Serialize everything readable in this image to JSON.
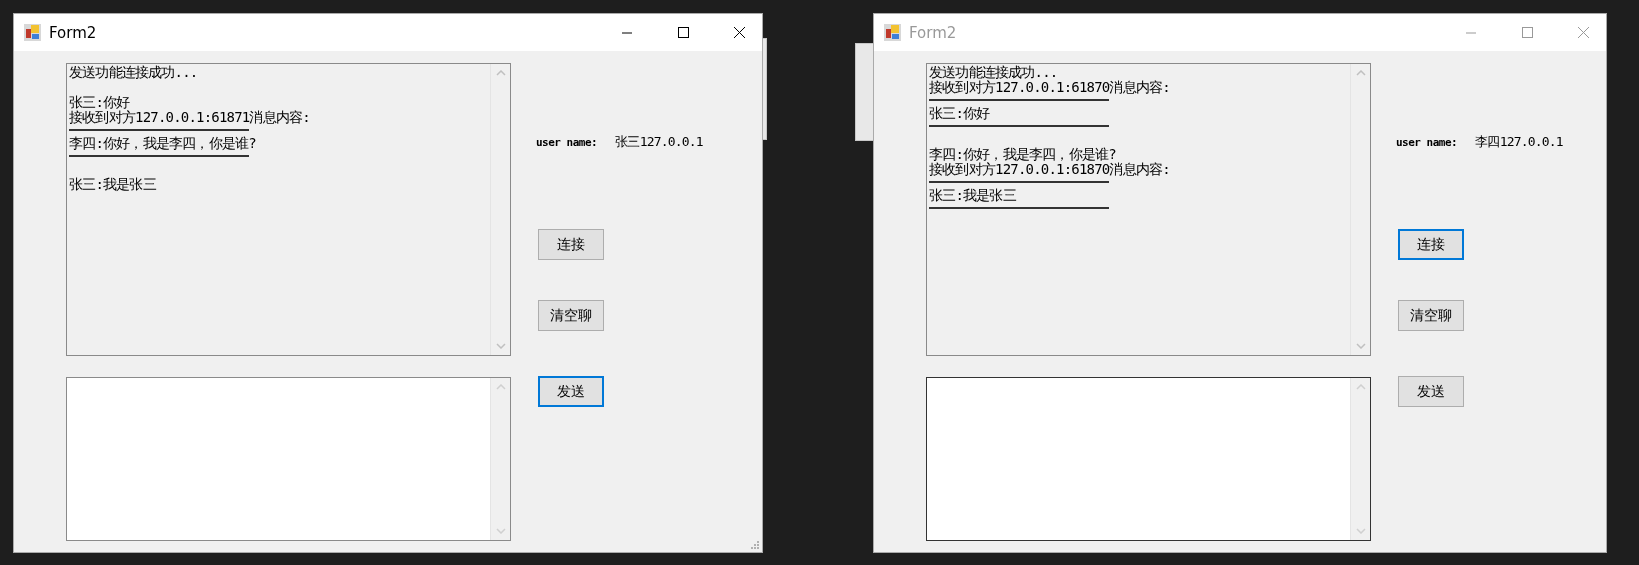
{
  "windows": [
    {
      "title": "Form2",
      "active": true,
      "chat_lines": [
        {
          "kind": "text",
          "text": "发送功能连接成功..."
        },
        {
          "kind": "blank"
        },
        {
          "kind": "text",
          "text": "张三:你好"
        },
        {
          "kind": "text",
          "text": "接收到对方127.0.0.1:61871消息内容:"
        },
        {
          "kind": "rule"
        },
        {
          "kind": "text",
          "text": "李四:你好，我是李四，你是谁?"
        },
        {
          "kind": "rule"
        },
        {
          "kind": "blank"
        },
        {
          "kind": "text",
          "text": "张三:我是张三"
        }
      ],
      "user_name_label": "user name:",
      "user_name_value": "张三127.0.0.1",
      "buttons": [
        {
          "label": "连接",
          "focused": false
        },
        {
          "label": "清空聊",
          "focused": false
        },
        {
          "label": "发送",
          "focused": true
        }
      ],
      "message_input": {
        "focused": false
      }
    },
    {
      "title": "Form2",
      "active": false,
      "chat_lines": [
        {
          "kind": "text",
          "text": "发送功能连接成功..."
        },
        {
          "kind": "text",
          "text": "接收到对方127.0.0.1:61870消息内容:"
        },
        {
          "kind": "rule"
        },
        {
          "kind": "text",
          "text": "张三:你好"
        },
        {
          "kind": "rule"
        },
        {
          "kind": "blank"
        },
        {
          "kind": "text",
          "text": "李四:你好，我是李四，你是谁?"
        },
        {
          "kind": "text",
          "text": "接收到对方127.0.0.1:61870消息内容:"
        },
        {
          "kind": "rule"
        },
        {
          "kind": "text",
          "text": "张三:我是张三"
        },
        {
          "kind": "rule"
        }
      ],
      "user_name_label": "user name:",
      "user_name_value": "李四127.0.0.1",
      "buttons": [
        {
          "label": "连接",
          "focused": true
        },
        {
          "label": "清空聊",
          "focused": false
        },
        {
          "label": "发送",
          "focused": false
        }
      ],
      "message_input": {
        "focused": true
      }
    }
  ]
}
